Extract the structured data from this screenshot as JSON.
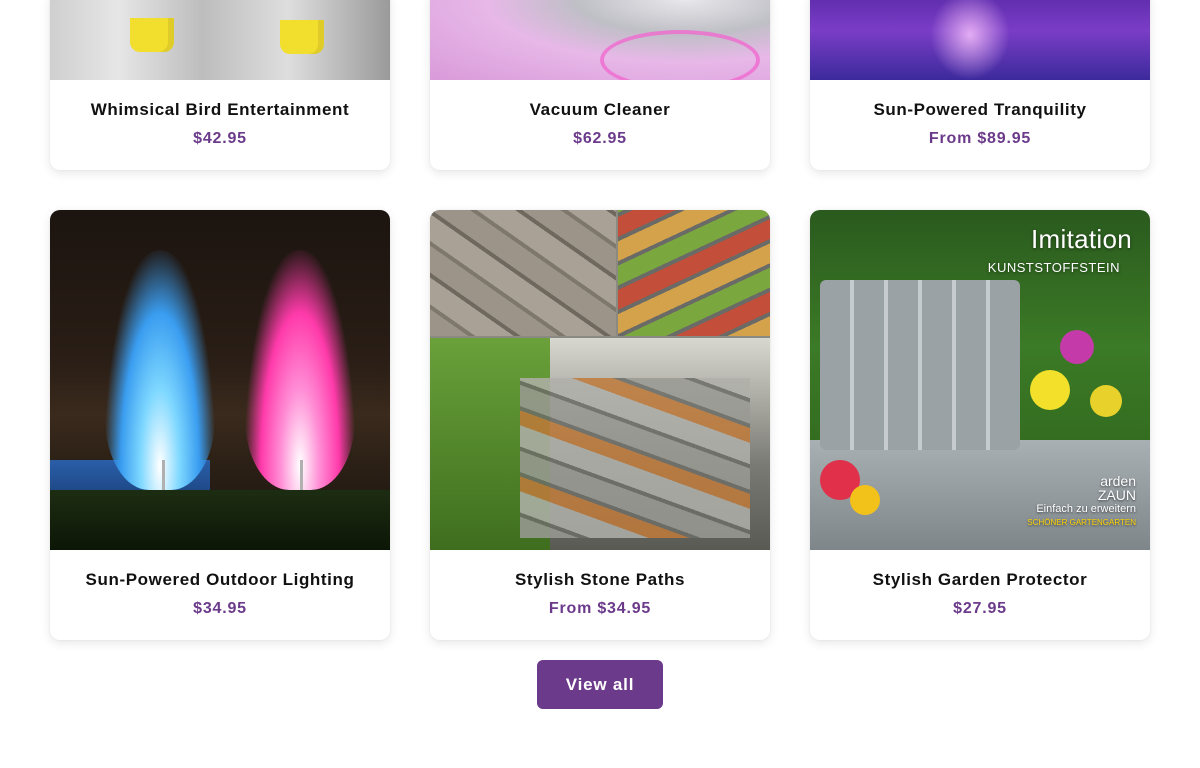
{
  "products": [
    {
      "title": "Whimsical Bird Entertainment",
      "price": "$42.95"
    },
    {
      "title": "Vacuum Cleaner",
      "price": "$62.95"
    },
    {
      "title": "Sun-Powered Tranquility",
      "price": "From $89.95"
    },
    {
      "title": "Sun-Powered Outdoor Lighting",
      "price": "$34.95"
    },
    {
      "title": "Stylish Stone Paths",
      "price": "From $34.95"
    },
    {
      "title": "Stylish Garden Protector",
      "price": "$27.95"
    }
  ],
  "images": {
    "garden_protector": {
      "headline": "Imitation",
      "subline": "KUNSTSTOFFSTEIN",
      "brand_line1": "arden",
      "brand_line2": "ZAUN",
      "tagline": "Einfach zu erweitern",
      "tagline2": "SCHÖNER GARTENGARTEN"
    }
  },
  "actions": {
    "view_all": "View all"
  },
  "colors": {
    "accent": "#6b3a8a",
    "title_text": "#111111"
  }
}
